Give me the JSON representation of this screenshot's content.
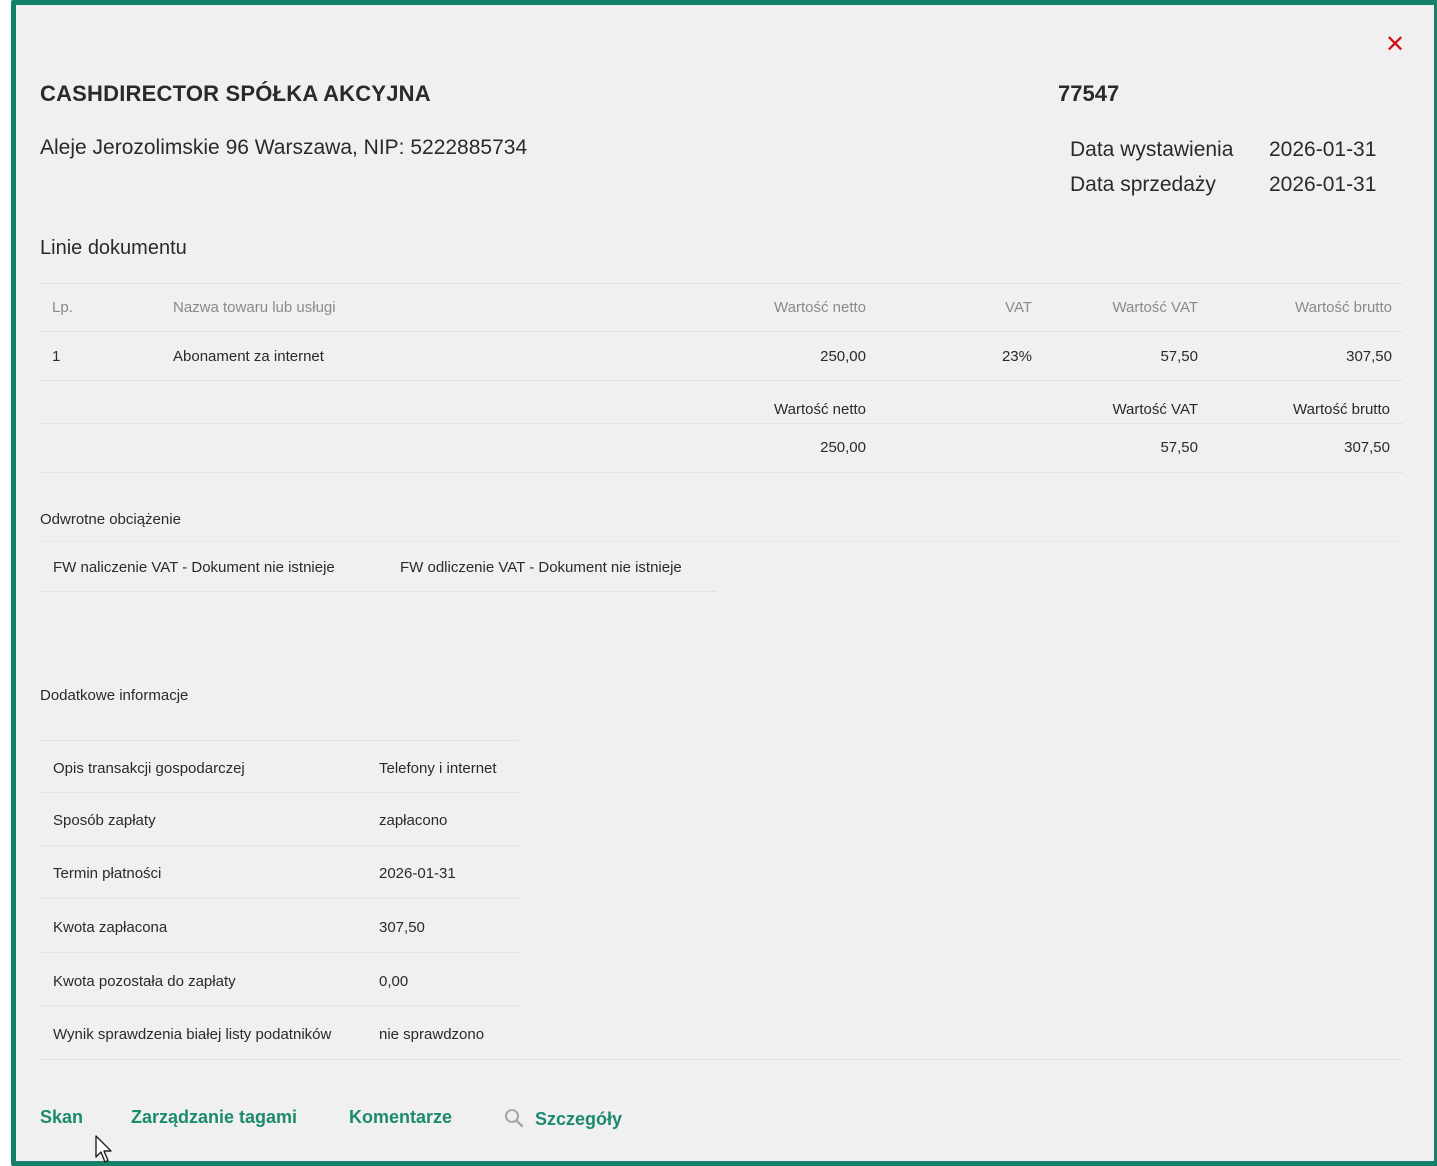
{
  "header": {
    "company_name": "CASHDIRECTOR SPÓŁKA AKCYJNA",
    "document_number": "77547",
    "address": "Aleje Jerozolimskie 96 Warszawa, NIP: 5222885734",
    "close_icon": "close-icon"
  },
  "dates": {
    "issue_label": "Data wystawienia",
    "issue_value": "2026-01-31",
    "sale_label": "Data sprzedaży",
    "sale_value": "2026-01-31"
  },
  "lines": {
    "title": "Linie dokumentu",
    "columns": {
      "lp": "Lp.",
      "name": "Nazwa towaru lub usługi",
      "net": "Wartość netto",
      "vat": "VAT",
      "vat_value": "Wartość VAT",
      "gross": "Wartość brutto"
    },
    "rows": [
      {
        "lp": "1",
        "name": "Abonament za internet",
        "net": "250,00",
        "vat": "23%",
        "vat_value": "57,50",
        "gross": "307,50"
      }
    ],
    "summary": {
      "net_label": "Wartość netto",
      "vat_label": "Wartość VAT",
      "gross_label": "Wartość brutto",
      "net": "250,00",
      "vat": "57,50",
      "gross": "307,50"
    }
  },
  "reverse_charge": {
    "title": "Odwrotne obciążenie",
    "item1": "FW naliczenie VAT - Dokument nie istnieje",
    "item2": "FW odliczenie VAT - Dokument nie istnieje"
  },
  "additional": {
    "title": "Dodatkowe informacje",
    "rows": [
      {
        "label": "Opis transakcji gospodarczej",
        "value": "Telefony i internet"
      },
      {
        "label": "Sposób zapłaty",
        "value": "zapłacono"
      },
      {
        "label": "Termin płatności",
        "value": "2026-01-31"
      },
      {
        "label": "Kwota zapłacona",
        "value": "307,50"
      },
      {
        "label": "Kwota pozostała do zapłaty",
        "value": "0,00"
      },
      {
        "label": "Wynik sprawdzenia białej listy podatników",
        "value": "nie sprawdzono"
      }
    ]
  },
  "footer": {
    "scan": "Skan",
    "tags": "Zarządzanie tagami",
    "comments": "Komentarze",
    "details": "Szczegóły",
    "details_icon": "search-icon"
  },
  "colors": {
    "accent": "#1c8a6e",
    "border": "#15806a",
    "close": "#d40f1b"
  }
}
